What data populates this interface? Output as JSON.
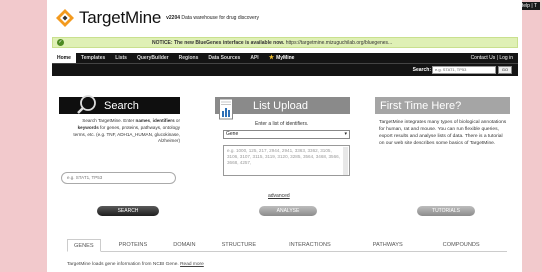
{
  "help_link": "Help | T",
  "header": {
    "title": "TargetMine",
    "version": "v2204",
    "tagline": "Data warehouse for drug discovery"
  },
  "notice": {
    "icon": "check-circle-icon",
    "text": "NOTICE: The new BlueGenes interface is available now.",
    "link": "https://targetmine.mizuguchilab.org/bluegenes..."
  },
  "nav": {
    "tabs": [
      "Home",
      "Templates",
      "Lists",
      "QueryBuilder",
      "Regions",
      "Data Sources",
      "API"
    ],
    "mymine": "MyMine",
    "right": "Contact Us | Log in"
  },
  "quick_search": {
    "label": "Search:",
    "placeholder": "e.g. STAT1, TP53",
    "go": "GO"
  },
  "search_panel": {
    "title": "Search",
    "desc_1": "Search TargetMine. Enter",
    "desc_bold_1": "names",
    "desc_sep": ", ",
    "desc_bold_2": "identifiers",
    "desc_or": " or ",
    "desc_bold_3": "keywords",
    "desc_2": " for genes, proteins, pathways, ontology terms, etc. (e.g. TNF, ADH1A_HUMAN, glucokinase, Alzheimer)",
    "placeholder": "e.g. STAT1, TP53",
    "button": "SEARCH"
  },
  "list_panel": {
    "title": "List Upload",
    "desc": "Enter a list of identifiers.",
    "type_value": "Gene",
    "textarea_text": "e.g. 1000, 125, 217, 2944, 2941, 3363, 3362, 3105, 3106, 3107, 3115, 3119, 3120, 3285, 3564, 3468, 3566, 3668, 4257,",
    "advanced": "advanced",
    "button": "ANALYSE"
  },
  "first_panel": {
    "title": "First Time Here?",
    "desc": "TargetMine integrates many types of biological annotations for human, rat and mouse. You can run flexible queries, export results and analyse lists of data. There is a tutorial on our web site describes some basics of TargetMine.",
    "button": "TUTORIALS"
  },
  "bottom_tabs": [
    "GENES",
    "PROTEINS",
    "DOMAIN",
    "STRUCTURE",
    "INTERACTIONS",
    "PATHWAYS",
    "COMPOUNDS"
  ],
  "tab_body": {
    "text": "TargetMine loads gene information from NCBI Gene.",
    "link": "Read more"
  }
}
